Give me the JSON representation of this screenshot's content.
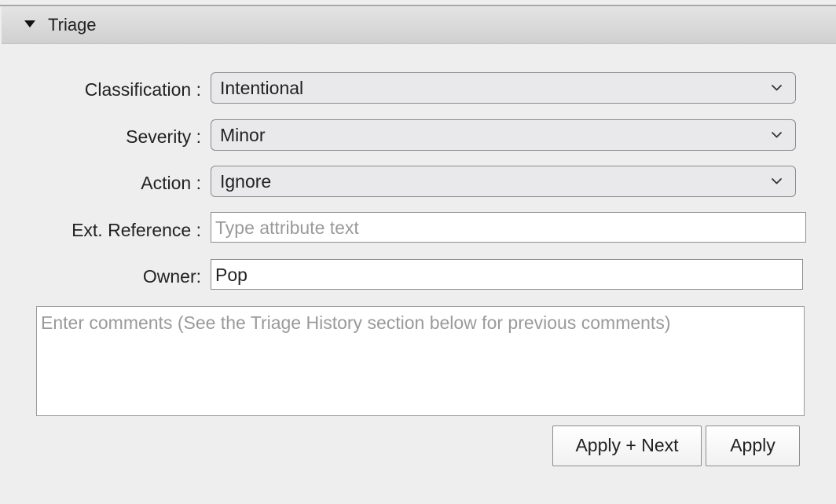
{
  "section": {
    "title": "Triage"
  },
  "fields": {
    "classification": {
      "label": "Classification :",
      "value": "Intentional"
    },
    "severity": {
      "label": "Severity :",
      "value": "Minor"
    },
    "action": {
      "label": "Action :",
      "value": "Ignore"
    },
    "ext_reference": {
      "label": "Ext. Reference :",
      "placeholder": "Type attribute text",
      "value": ""
    },
    "owner": {
      "label": "Owner:",
      "value": "Pop"
    }
  },
  "comments": {
    "placeholder": "Enter comments (See the Triage History section below for previous comments)",
    "value": ""
  },
  "buttons": {
    "apply_next": "Apply + Next",
    "apply": "Apply"
  },
  "icons": {
    "section_toggle": "triangle-down-icon",
    "select_arrow": "chevron-down-icon"
  }
}
